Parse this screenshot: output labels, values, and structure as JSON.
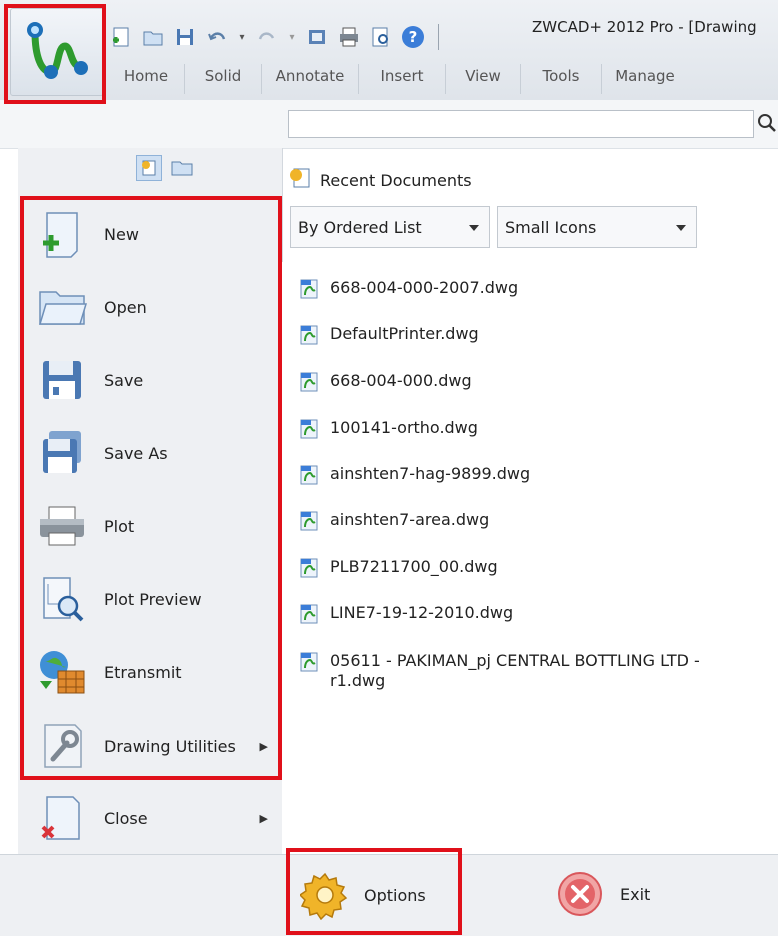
{
  "window": {
    "title": "ZWCAD+ 2012 Pro - [Drawing"
  },
  "ribbon": {
    "tabs": [
      "Home",
      "Solid",
      "Annotate",
      "Insert",
      "View",
      "Tools",
      "Manage"
    ]
  },
  "search": {
    "value": "",
    "placeholder": ""
  },
  "menu": {
    "items": [
      {
        "label": "New",
        "icon": "new-document-icon"
      },
      {
        "label": "Open",
        "icon": "folder-open-icon"
      },
      {
        "label": "Save",
        "icon": "save-icon"
      },
      {
        "label": "Save As",
        "icon": "save-as-icon"
      },
      {
        "label": "Plot",
        "icon": "printer-icon"
      },
      {
        "label": "Plot Preview",
        "icon": "plot-preview-icon"
      },
      {
        "label": "Etransmit",
        "icon": "etransmit-icon"
      },
      {
        "label": "Drawing Utilities",
        "icon": "wrench-icon",
        "submenu": true
      },
      {
        "label": "Close",
        "icon": "close-document-icon",
        "submenu": true
      }
    ]
  },
  "recent": {
    "header": "Recent Documents",
    "sort_option": "By Ordered List",
    "view_option": "Small Icons",
    "documents": [
      "668-004-000-2007.dwg",
      "DefaultPrinter.dwg",
      "668-004-000.dwg",
      "100141-ortho.dwg",
      "ainshten7-hag-9899.dwg",
      "ainshten7-area.dwg",
      "PLB7211700_00.dwg",
      "LINE7-19-12-2010.dwg",
      "05611 - PAKIMAN_pj CENTRAL BOTTLING LTD - r1.dwg"
    ]
  },
  "footer": {
    "options_label": "Options",
    "exit_label": "Exit"
  },
  "colors": {
    "highlight": "#e0101a",
    "accent": "#2a7ab8"
  }
}
